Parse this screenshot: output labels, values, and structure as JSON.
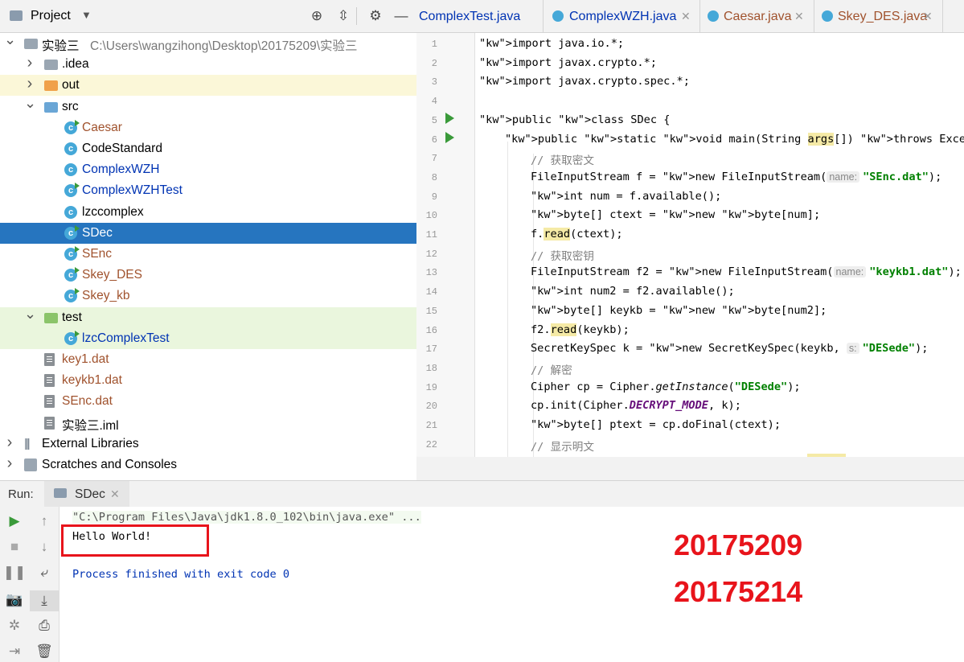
{
  "project": {
    "title": "Project",
    "tree": [
      {
        "label": "实验三",
        "path": "C:\\Users\\wangzihong\\Desktop\\20175209\\实验三",
        "arrow": "⌄",
        "icon": "module-folder",
        "color": "#000"
      },
      {
        "label": ".idea",
        "arrow": "›",
        "icon": "folder",
        "color": "#000"
      },
      {
        "label": "out",
        "arrow": "›",
        "icon": "folder-orange",
        "color": "#000"
      },
      {
        "label": "src",
        "arrow": "⌄",
        "icon": "folder-blue",
        "color": "#000"
      },
      {
        "label": "Caesar",
        "icon": "class-run",
        "color": "#a0522d"
      },
      {
        "label": "CodeStandard",
        "icon": "class",
        "color": "#000"
      },
      {
        "label": "ComplexWZH",
        "icon": "class",
        "color": "#0033b3"
      },
      {
        "label": "ComplexWZHTest",
        "icon": "class-run",
        "color": "#0033b3"
      },
      {
        "label": "lzccomplex",
        "icon": "class",
        "color": "#000"
      },
      {
        "label": "SDec",
        "icon": "class-run",
        "color": "#fff"
      },
      {
        "label": "SEnc",
        "icon": "class-run",
        "color": "#a0522d"
      },
      {
        "label": "Skey_DES",
        "icon": "class-run",
        "color": "#a0522d"
      },
      {
        "label": "Skey_kb",
        "icon": "class-run",
        "color": "#a0522d"
      },
      {
        "label": "test",
        "arrow": "⌄",
        "icon": "folder-green",
        "color": "#000"
      },
      {
        "label": "lzcComplexTest",
        "icon": "class-run",
        "color": "#0033b3"
      },
      {
        "label": "key1.dat",
        "icon": "file",
        "color": "#a0522d"
      },
      {
        "label": "keykb1.dat",
        "icon": "file",
        "color": "#a0522d"
      },
      {
        "label": "SEnc.dat",
        "icon": "file",
        "color": "#a0522d"
      },
      {
        "label": "实验三.iml",
        "icon": "file",
        "color": "#000"
      },
      {
        "label": "External Libraries",
        "arrow": "›",
        "icon": "libraries",
        "color": "#000"
      },
      {
        "label": "Scratches and Consoles",
        "arrow": "›",
        "icon": "scratches",
        "color": "#000"
      }
    ]
  },
  "editor": {
    "tabs": [
      {
        "label": "ComplexTest.java",
        "color": "#0033b3"
      },
      {
        "label": "ComplexWZH.java",
        "color": "#0033b3"
      },
      {
        "label": "Caesar.java",
        "color": "#a0522d"
      },
      {
        "label": "Skey_DES.java",
        "color": "#a0522d"
      }
    ],
    "line_numbers": [
      "1",
      "2",
      "3",
      "4",
      "5",
      "6",
      "7",
      "8",
      "9",
      "10",
      "11",
      "12",
      "13",
      "14",
      "15",
      "16",
      "17",
      "18",
      "19",
      "20",
      "21",
      "22"
    ],
    "code": {
      "l1": "import java.io.*;",
      "l2": "import javax.crypto.*;",
      "l3": "import javax.crypto.spec.*;",
      "l5": "public class SDec {",
      "l6": "public static void main(String args[]) throws Exception {",
      "l7": "// 获取密文",
      "l8a": "FileInputStream f = new FileInputStream(",
      "l8hint": "name:",
      "l8str": "\"SEnc.dat\"",
      "l8end": ");",
      "l9": "int num = f.available();",
      "l10": "byte[] ctext = new byte[num];",
      "l11": "f.read(ctext);",
      "l12": "// 获取密钥",
      "l13a": "FileInputStream f2 = new FileInputStream(",
      "l13hint": "name:",
      "l13str": "\"keykb1.dat\"",
      "l13end": ");",
      "l14": "int num2 = f2.available();",
      "l15": "byte[] keykb = new byte[num2];",
      "l16": "f2.read(keykb);",
      "l17a": "SecretKeySpec k = new SecretKeySpec(keykb,",
      "l17hint": "s:",
      "l17str": "\"DESede\"",
      "l17end": ");",
      "l18": "// 解密",
      "l19": "Cipher cp = Cipher.getInstance(\"DESede\");",
      "l20": "cp.init(Cipher.DECRYPT_MODE, k);",
      "l21": "byte[] ptext = cp.doFinal(ctext);",
      "l22": "// 显示明文"
    }
  },
  "run": {
    "label": "Run:",
    "tab": "SDec",
    "cmd": "\"C:\\Program Files\\Java\\jdk1.8.0_102\\bin\\java.exe\" ...",
    "output": "Hello World!",
    "finished": "Process finished with exit code 0",
    "num1": "20175209",
    "num2": "20175214"
  }
}
